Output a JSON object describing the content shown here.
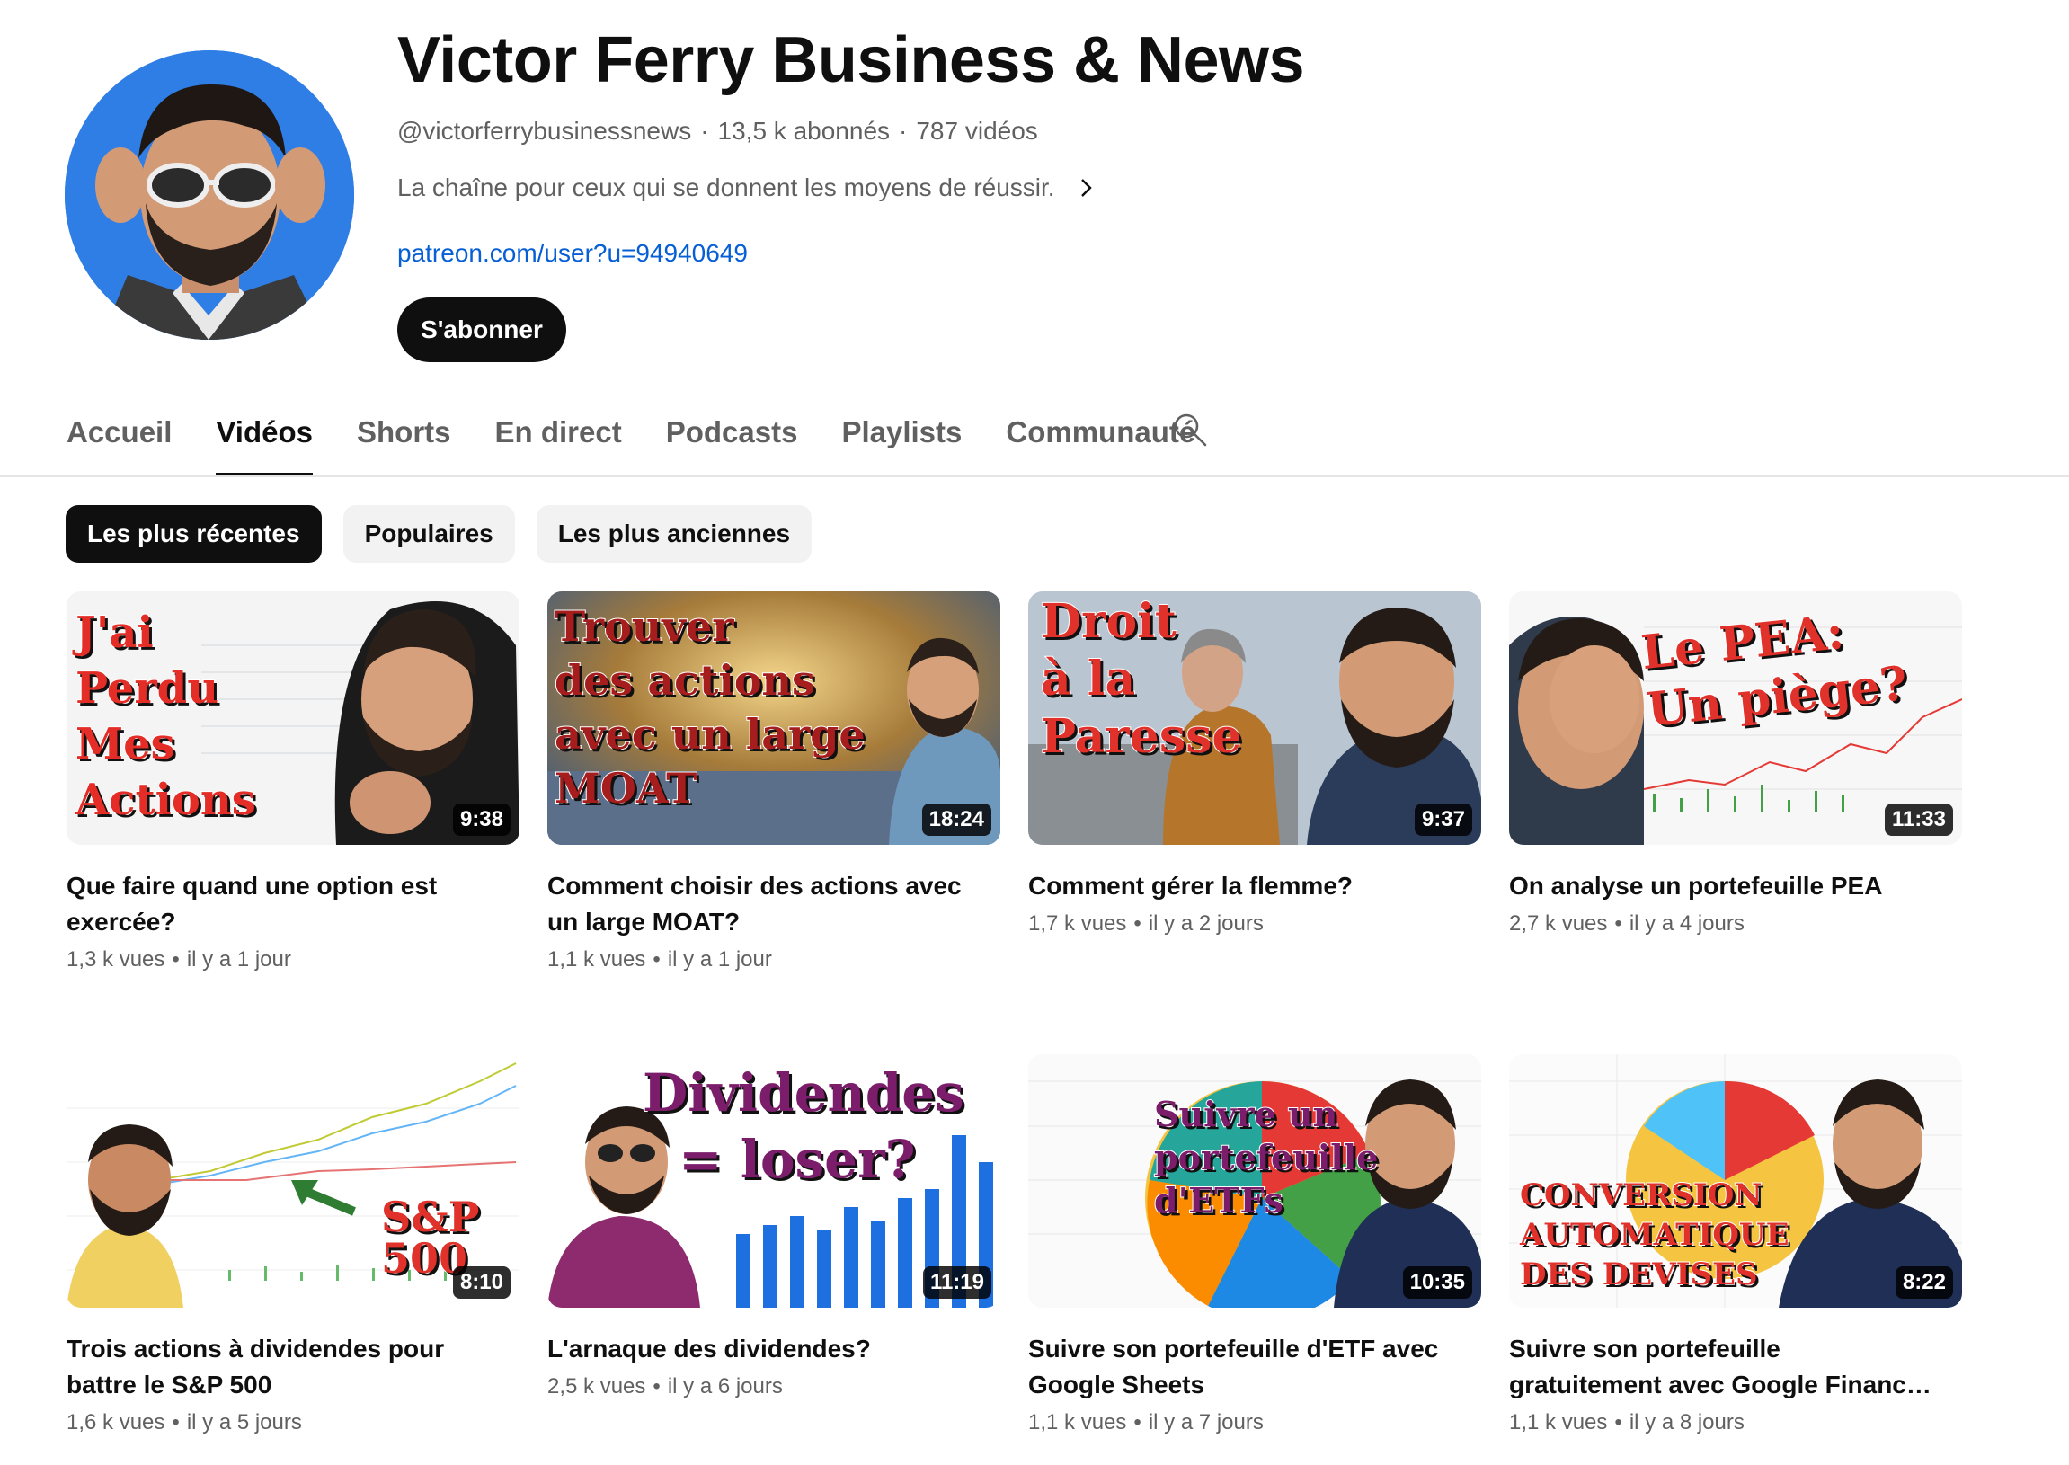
{
  "channel": {
    "name": "Victor Ferry Business & News",
    "handle": "@victorferrybusinessnews",
    "subscribers": "13,5 k abonnés",
    "video_count": "787 vidéos",
    "description": "La chaîne pour ceux qui se donnent les moyens de réussir.",
    "link": "patreon.com/user?u=94940649",
    "subscribe_label": "S'abonner"
  },
  "tabs": [
    {
      "label": "Accueil",
      "active": false
    },
    {
      "label": "Vidéos",
      "active": true
    },
    {
      "label": "Shorts",
      "active": false
    },
    {
      "label": "En direct",
      "active": false
    },
    {
      "label": "Podcasts",
      "active": false
    },
    {
      "label": "Playlists",
      "active": false
    },
    {
      "label": "Communauté",
      "active": false
    }
  ],
  "chips": [
    {
      "label": "Les plus récentes",
      "active": true
    },
    {
      "label": "Populaires",
      "active": false
    },
    {
      "label": "Les plus anciennes",
      "active": false
    }
  ],
  "videos": [
    {
      "title": "Que faire quand une option est exercée?",
      "views": "1,3 k vues",
      "age": "il y a 1 jour",
      "duration": "9:38",
      "thumb_text": [
        "J'ai",
        "Perdu",
        "Mes",
        "Actions"
      ]
    },
    {
      "title": "Comment choisir des actions avec un large MOAT?",
      "views": "1,1 k vues",
      "age": "il y a 1 jour",
      "duration": "18:24",
      "thumb_text": [
        "Trouver",
        "des actions",
        "avec un large",
        "MOAT"
      ]
    },
    {
      "title": "Comment gérer la flemme?",
      "views": "1,7 k vues",
      "age": "il y a 2 jours",
      "duration": "9:37",
      "thumb_text": [
        "Droit",
        "à la",
        "Paresse"
      ]
    },
    {
      "title": "On analyse un portefeuille PEA",
      "views": "2,7 k vues",
      "age": "il y a 4 jours",
      "duration": "11:33",
      "thumb_text": [
        "Le PEA:",
        "Un piège?"
      ]
    },
    {
      "title": "Trois actions à dividendes pour battre le S&P 500",
      "views": "1,6 k vues",
      "age": "il y a 5 jours",
      "duration": "8:10",
      "thumb_text": [
        "S&P 500"
      ]
    },
    {
      "title": "L'arnaque des dividendes?",
      "views": "2,5 k vues",
      "age": "il y a 6 jours",
      "duration": "11:19",
      "thumb_text": [
        "Dividendes",
        "= loser?"
      ]
    },
    {
      "title": "Suivre son portefeuille d'ETF avec Google Sheets",
      "views": "1,1 k vues",
      "age": "il y a 7 jours",
      "duration": "10:35",
      "thumb_text": [
        "Suivre un",
        "portefeuille",
        "d'ETFs"
      ]
    },
    {
      "title": "Suivre son portefeuille gratuitement avec Google Finance: la conversio…",
      "views": "1,1 k vues",
      "age": "il y a 8 jours",
      "duration": "8:22",
      "thumb_text": [
        "CONVERSION",
        "AUTOMATIQUE",
        "DES DEVISES"
      ]
    }
  ],
  "icons": {
    "search": "search-icon",
    "chevron": "chevron-right-icon",
    "avatar": "channel-avatar"
  }
}
